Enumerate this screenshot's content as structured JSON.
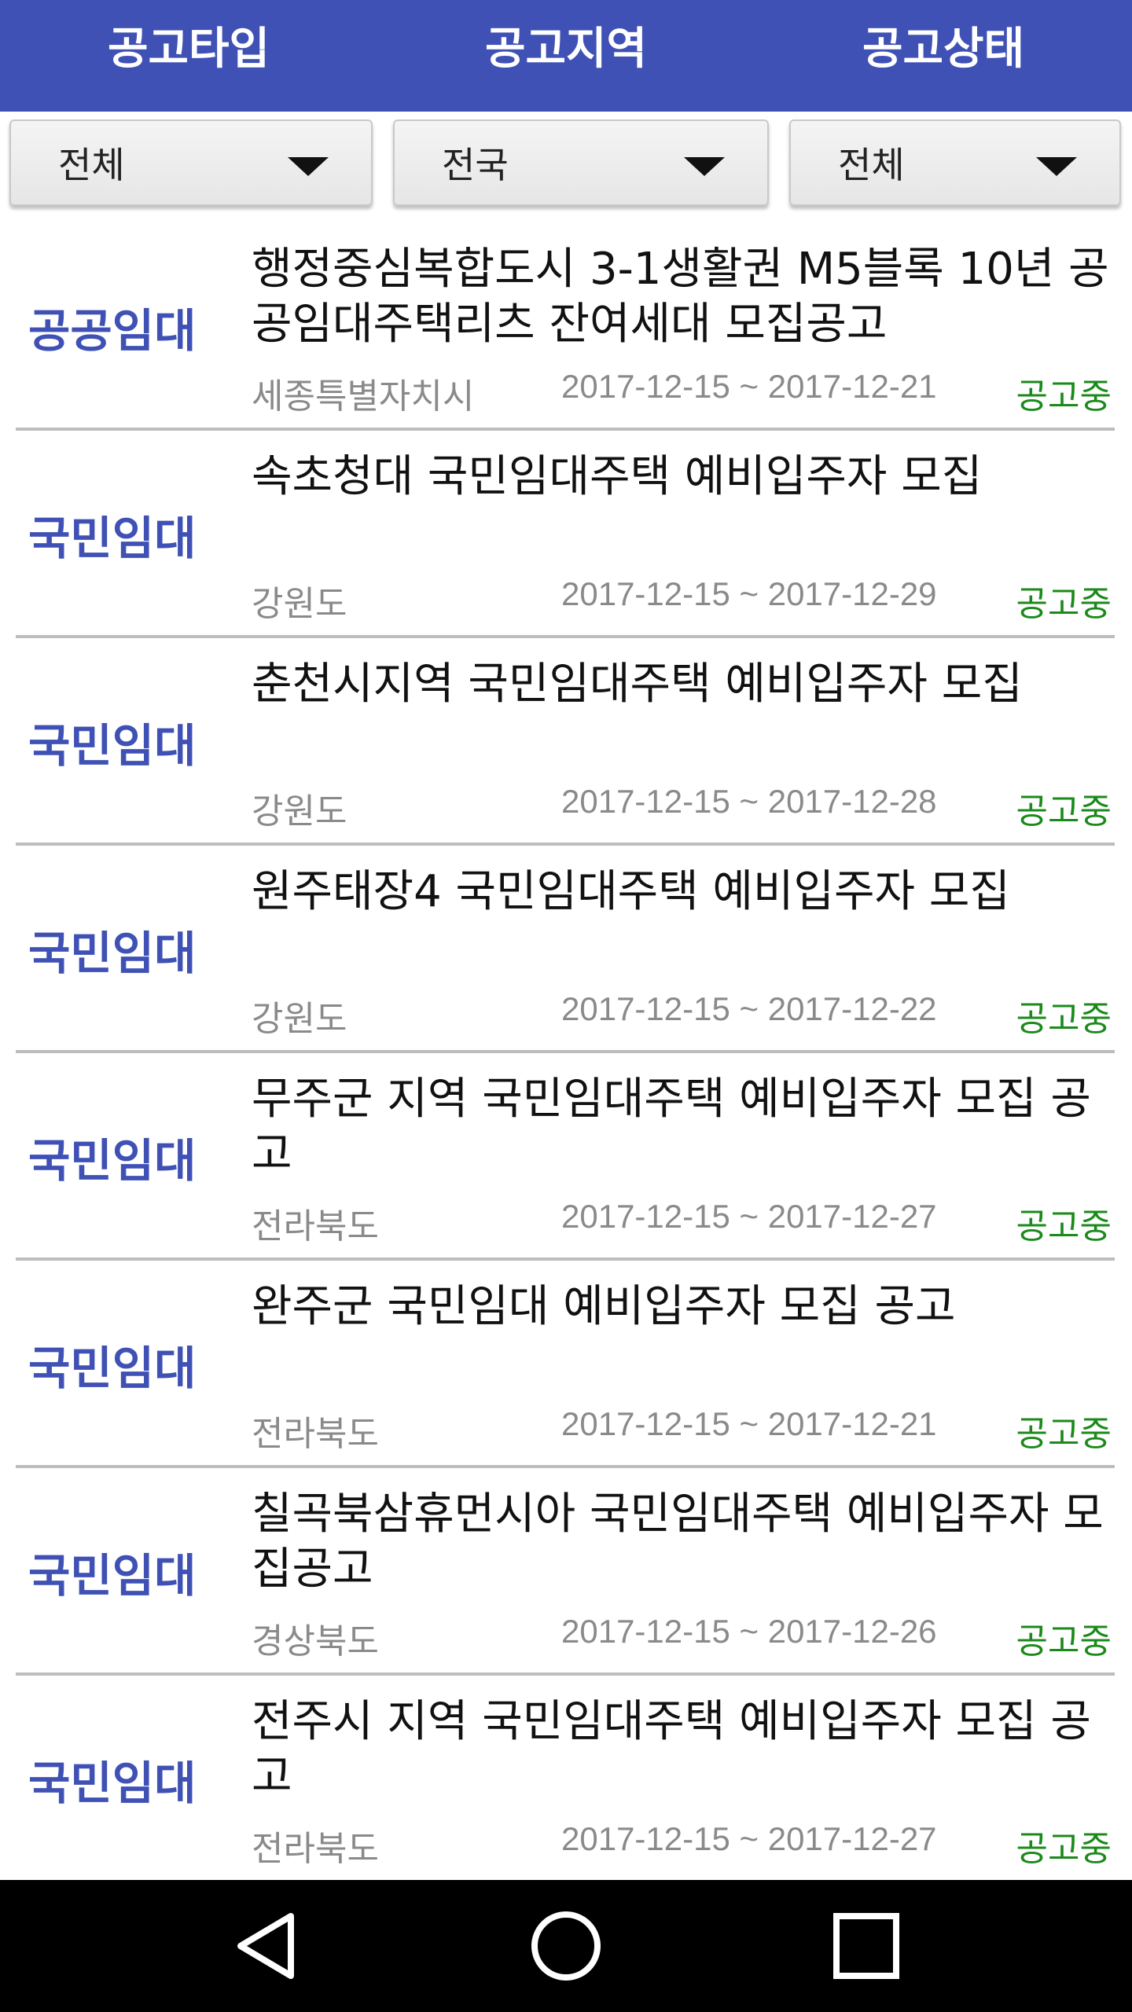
{
  "header": {
    "tabs": [
      {
        "label": "공고타입"
      },
      {
        "label": "공고지역"
      },
      {
        "label": "공고상태"
      }
    ]
  },
  "filters": {
    "type_value": "전체",
    "region_value": "전국",
    "status_value": "전체"
  },
  "notices": [
    {
      "type": "공공임대",
      "title": "행정중심복합도시 3-1생활권 M5블록 10년 공공임대주택리츠 잔여세대 모집공고",
      "region": "세종특별자치시",
      "period": "2017-12-15 ~ 2017-12-21",
      "status": "공고중"
    },
    {
      "type": "국민임대",
      "title": "속초청대 국민임대주택 예비입주자 모집",
      "region": "강원도",
      "period": "2017-12-15 ~ 2017-12-29",
      "status": "공고중"
    },
    {
      "type": "국민임대",
      "title": "춘천시지역 국민임대주택 예비입주자 모집",
      "region": "강원도",
      "period": "2017-12-15 ~ 2017-12-28",
      "status": "공고중"
    },
    {
      "type": "국민임대",
      "title": "원주태장4 국민임대주택 예비입주자 모집",
      "region": "강원도",
      "period": "2017-12-15 ~ 2017-12-22",
      "status": "공고중"
    },
    {
      "type": "국민임대",
      "title": "무주군 지역 국민임대주택 예비입주자 모집 공고",
      "region": "전라북도",
      "period": "2017-12-15 ~ 2017-12-27",
      "status": "공고중"
    },
    {
      "type": "국민임대",
      "title": "완주군 국민임대 예비입주자 모집 공고",
      "region": "전라북도",
      "period": "2017-12-15 ~ 2017-12-21",
      "status": "공고중"
    },
    {
      "type": "국민임대",
      "title": "칠곡북삼휴먼시아 국민임대주택 예비입주자 모집공고",
      "region": "경상북도",
      "period": "2017-12-15 ~ 2017-12-26",
      "status": "공고중"
    },
    {
      "type": "국민임대",
      "title": "전주시 지역 국민임대주택 예비입주자 모집 공고",
      "region": "전라북도",
      "period": "2017-12-15 ~ 2017-12-27",
      "status": "공고중"
    }
  ],
  "navbar": {
    "icons": [
      "back-icon",
      "home-icon",
      "recents-icon"
    ]
  },
  "colors": {
    "accent": "#3f51b5",
    "status_active": "#1b8a1b",
    "meta_text": "#8a8a8a"
  }
}
